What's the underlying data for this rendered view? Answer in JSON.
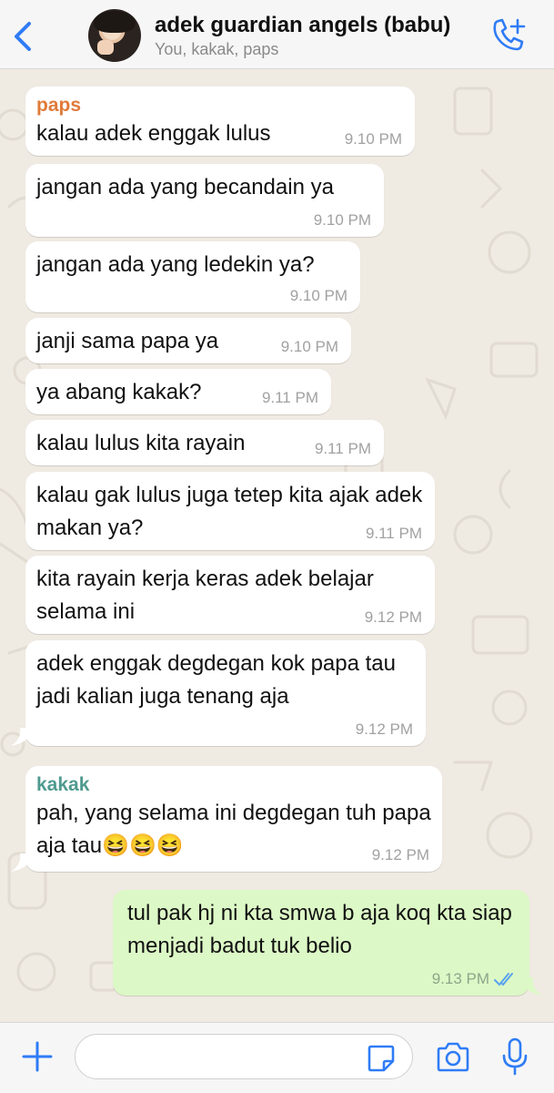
{
  "header": {
    "title": "adek guardian angels (babu)",
    "subtitle": "You, kakak, paps",
    "back_icon": "chevron-left-icon",
    "call_icon": "phone-add-icon",
    "accent": "#2f7cf6"
  },
  "messages": [
    {
      "direction": "in",
      "sender": "paps",
      "sender_color": "#e07b39",
      "text": "kalau adek enggak lulus",
      "time": "9.10 PM"
    },
    {
      "direction": "in",
      "text": "jangan ada yang becandain ya",
      "time": "9.10 PM"
    },
    {
      "direction": "in",
      "text": "jangan ada yang ledekin ya?",
      "time": "9.10 PM"
    },
    {
      "direction": "in",
      "text": "janji sama papa ya",
      "time": "9.10 PM"
    },
    {
      "direction": "in",
      "text": "ya abang kakak?",
      "time": "9.11 PM"
    },
    {
      "direction": "in",
      "text": "kalau lulus kita rayain",
      "time": "9.11 PM"
    },
    {
      "direction": "in",
      "text": "kalau gak lulus juga tetep kita ajak adek makan ya?",
      "time": "9.11 PM"
    },
    {
      "direction": "in",
      "text": "kita rayain kerja keras adek belajar selama ini",
      "time": "9.12 PM"
    },
    {
      "direction": "in",
      "text": "adek enggak degdegan kok papa tau jadi kalian juga tenang aja",
      "time": "9.12 PM"
    },
    {
      "direction": "in",
      "sender": "kakak",
      "sender_color": "#4f9a8f",
      "text": "pah, yang selama ini degdegan tuh papa aja tau😆😆😆",
      "time": "9.12 PM"
    },
    {
      "direction": "out",
      "text": "tul pak hj ni kta smwa b aja koq kta siap menjadi badut tuk belio",
      "time": "9.13 PM",
      "status": "read"
    }
  ],
  "input": {
    "value": "",
    "plus_icon": "plus-icon",
    "sticker_icon": "sticker-icon",
    "camera_icon": "camera-icon",
    "mic_icon": "microphone-icon"
  }
}
